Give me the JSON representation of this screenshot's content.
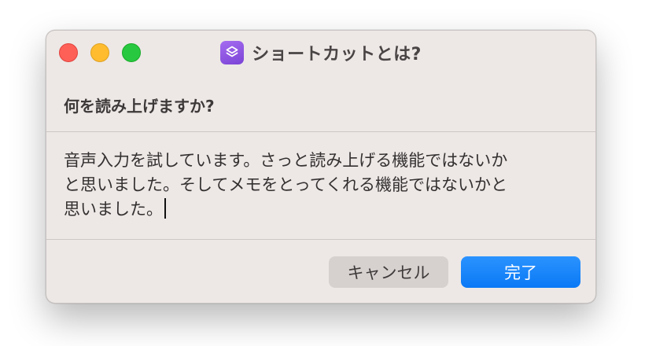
{
  "window": {
    "title": "ショートカットとは?",
    "app_icon": "shortcuts-icon"
  },
  "traffic_lights": {
    "close_color": "#fe5f57",
    "minimize_color": "#febc2e",
    "zoom_color": "#28c840"
  },
  "dialog": {
    "question": "何を読み上げますか?",
    "text_lines": [
      "音声入力を試しています。さっと読み上げる機能ではないか",
      "と思いました。そしてメモをとってくれる機能ではないかと",
      "思いました。"
    ]
  },
  "buttons": {
    "cancel_label": "キャンセル",
    "done_label": "完了",
    "done_color": "#0a79f5"
  }
}
